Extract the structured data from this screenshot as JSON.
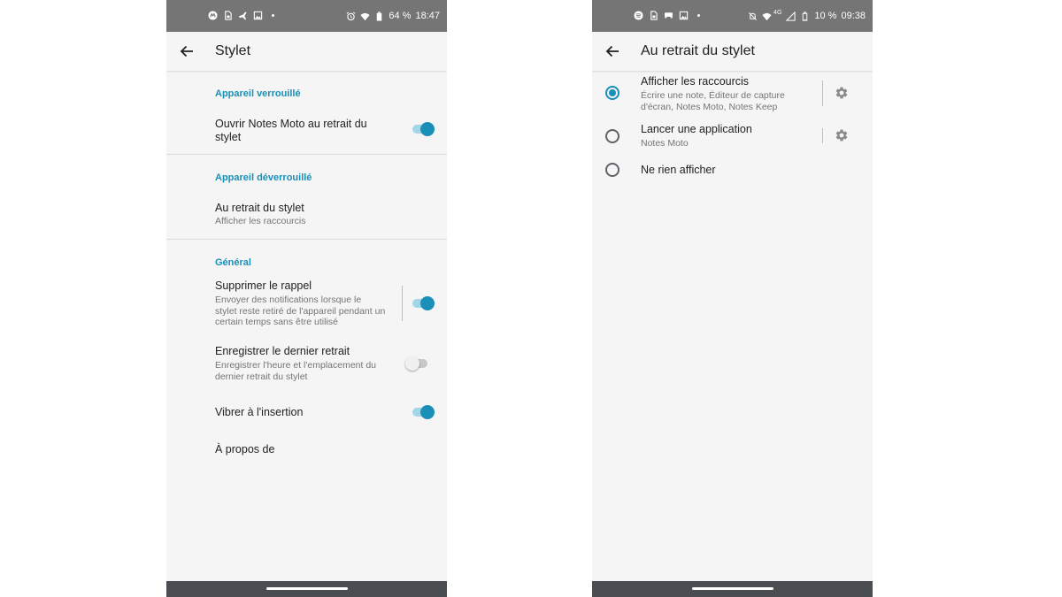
{
  "colors": {
    "accent": "#1a8fb7",
    "statusbar": "#757575",
    "navbar": "#4a4e52",
    "background": "#f5f5f5"
  },
  "left": {
    "status": {
      "battery": "64 %",
      "time": "18:47",
      "left_icons": [
        "motorola-icon",
        "sim-icon",
        "flight-icon",
        "image-icon",
        "dot-icon"
      ],
      "right_icons": [
        "alarm-icon",
        "wifi-icon",
        "battery-icon"
      ]
    },
    "title": "Stylet",
    "sections": {
      "locked": {
        "header": "Appareil verrouillé",
        "open_notes": {
          "title": "Ouvrir Notes Moto au retrait du stylet",
          "title_line1": "Ouvrir Notes Moto au retrait du",
          "title_line2": "stylet",
          "enabled": true
        }
      },
      "unlocked": {
        "header": "Appareil déverrouillé",
        "removal": {
          "title": "Au retrait du stylet",
          "summary": "Afficher les raccourcis"
        }
      },
      "general": {
        "header": "Général",
        "remove_reminder": {
          "title": "Supprimer le rappel",
          "summary_l1": "Envoyer des notifications lorsque le",
          "summary_l2": "stylet reste retiré de l'appareil pendant un",
          "summary_l3": "certain temps sans être utilisé",
          "enabled": true
        },
        "record_last": {
          "title": "Enregistrer le dernier retrait",
          "summary_l1": "Enregistrer l'heure et l'emplacement du",
          "summary_l2": "dernier retrait du stylet",
          "enabled": false
        },
        "vibrate": {
          "title": "Vibrer à l'insertion",
          "enabled": true
        },
        "about": {
          "title": "À propos de"
        }
      }
    }
  },
  "right": {
    "status": {
      "network": "4G",
      "battery": "10 %",
      "time": "09:38",
      "left_icons": [
        "spotify-icon",
        "sim-icon",
        "game-icon",
        "image-icon",
        "dot-icon"
      ],
      "right_icons": [
        "mute-icon",
        "wifi-icon",
        "signal-icon",
        "battery-icon"
      ]
    },
    "title": "Au retrait du stylet",
    "options": [
      {
        "title": "Afficher les raccourcis",
        "summary_l1": "Écrire une note, Éditeur de capture",
        "summary_l2": "d'écran, Notes Moto, Notes Keep",
        "selected": true
      },
      {
        "title": "Lancer une application",
        "summary_l1": "Notes Moto",
        "selected": false
      },
      {
        "title": "Ne rien afficher",
        "selected": false
      }
    ]
  }
}
